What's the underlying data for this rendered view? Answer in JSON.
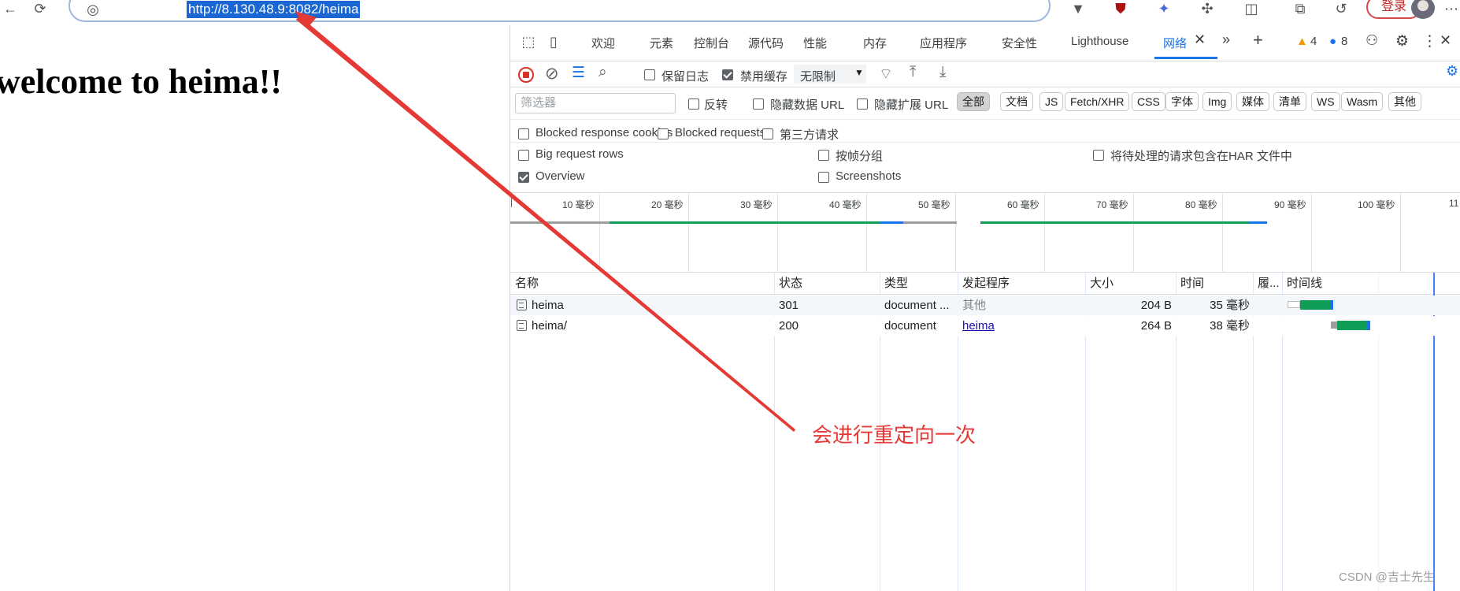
{
  "browser": {
    "url": "http://8.130.48.9:8082/heima",
    "login_label": "登录"
  },
  "page": {
    "heading": "welcome to heima!!"
  },
  "devtools": {
    "tabs": [
      "欢迎",
      "元素",
      "控制台",
      "源代码",
      "性能",
      "内存",
      "应用程序",
      "安全性",
      "Lighthouse",
      "网络"
    ],
    "warnings_count": "4",
    "messages_count": "8",
    "toolbar": {
      "preserve_log": "保留日志",
      "disable_cache": "禁用缓存",
      "throttle": "无限制"
    },
    "filter": {
      "placeholder": "筛选器",
      "invert": "反转",
      "hide_data_urls": "隐藏数据 URL",
      "hide_ext_urls": "隐藏扩展 URL",
      "types": [
        "全部",
        "文档",
        "JS",
        "Fetch/XHR",
        "CSS",
        "字体",
        "Img",
        "媒体",
        "清单",
        "WS",
        "Wasm",
        "其他"
      ]
    },
    "options": {
      "blocked_cookies": "Blocked response cookies",
      "blocked_requests": "Blocked requests",
      "third_party": "第三方请求",
      "big_rows": "Big request rows",
      "group_by_frame": "按帧分组",
      "har_pending": "将待处理的请求包含在HAR 文件中",
      "overview": "Overview",
      "screenshots": "Screenshots"
    },
    "timeline_ticks": [
      "10 毫秒",
      "20 毫秒",
      "30 毫秒",
      "40 毫秒",
      "50 毫秒",
      "60 毫秒",
      "70 毫秒",
      "80 毫秒",
      "90 毫秒",
      "100 毫秒",
      "11"
    ],
    "columns": [
      "名称",
      "状态",
      "类型",
      "发起程序",
      "大小",
      "时间",
      "履...",
      "时间线"
    ],
    "rows": [
      {
        "name": "heima",
        "status": "301",
        "type": "document ...",
        "initiator": "其他",
        "size": "204 B",
        "time": "35  毫秒"
      },
      {
        "name": "heima/",
        "status": "200",
        "type": "document",
        "initiator": "heima",
        "size": "264 B",
        "time": "38  毫秒"
      }
    ]
  },
  "annotation": "会进行重定向一次",
  "watermark": "CSDN @吉士先生",
  "colors": {
    "accent": "#1a73e8",
    "annotation_red": "#e53935",
    "green_bar": "#0f9d58"
  }
}
